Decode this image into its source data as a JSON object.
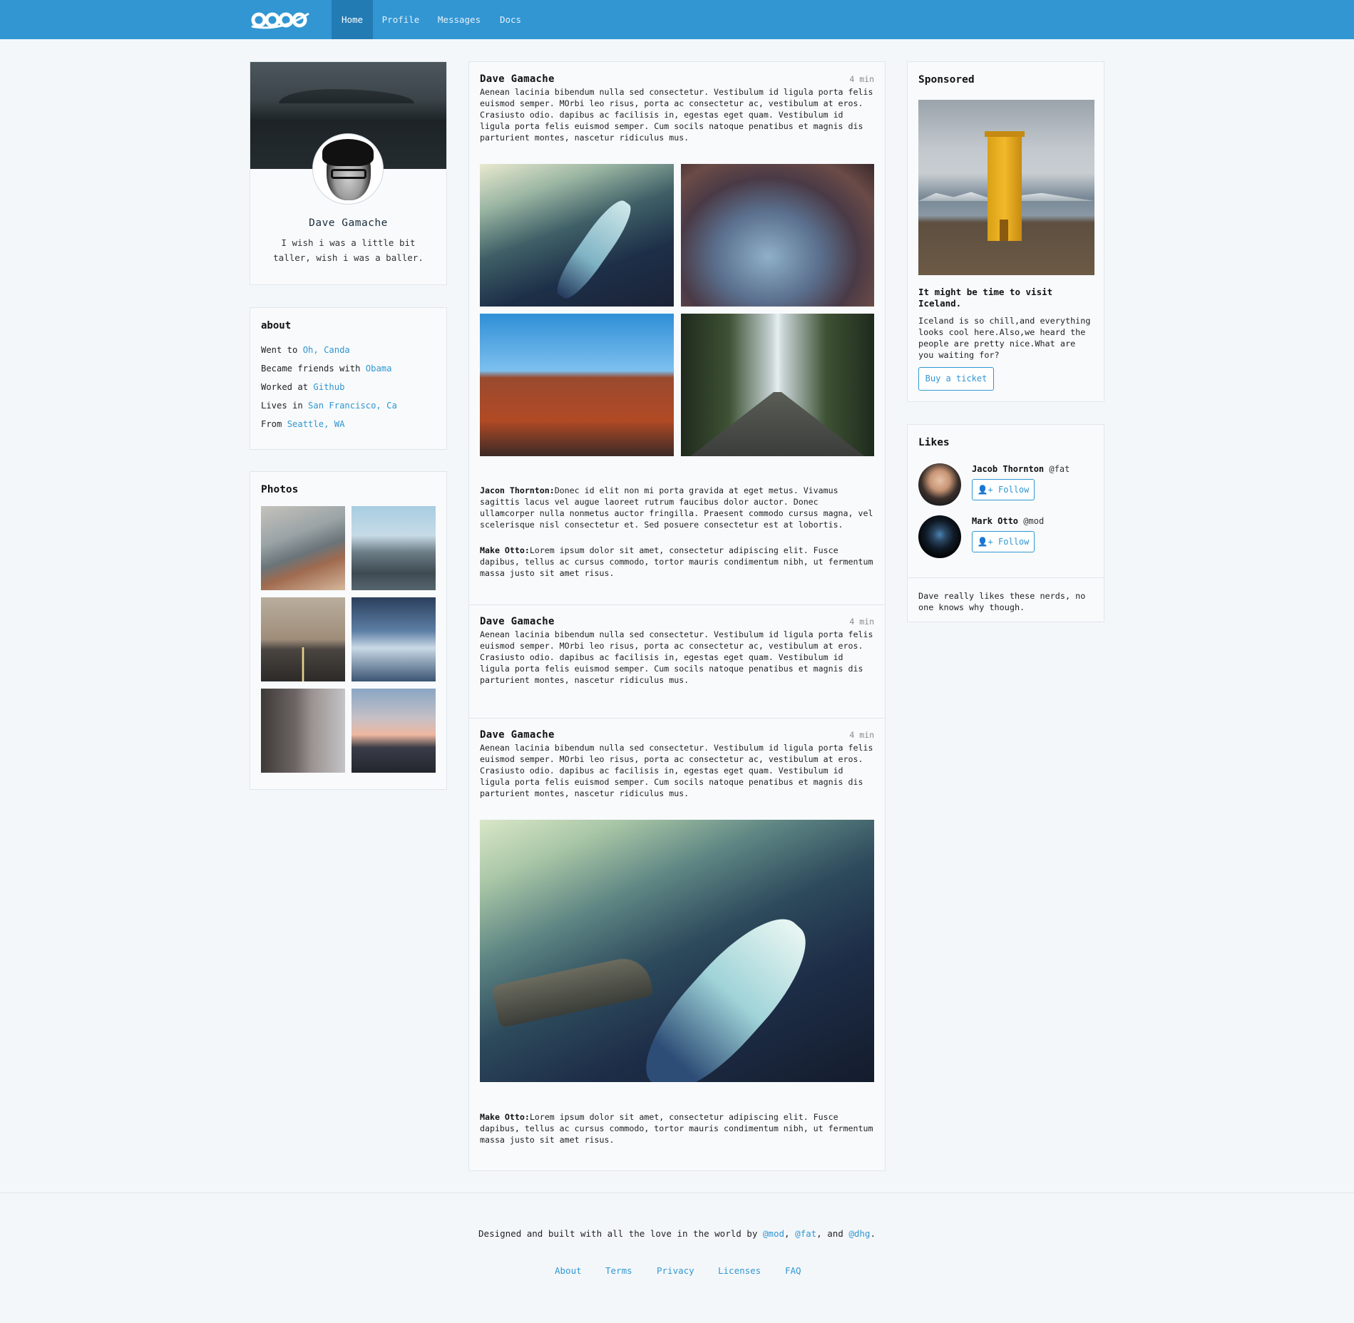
{
  "nav": {
    "items": [
      {
        "label": "Home",
        "active": true
      },
      {
        "label": "Profile",
        "active": false
      },
      {
        "label": "Messages",
        "active": false
      },
      {
        "label": "Docs",
        "active": false
      }
    ]
  },
  "profile": {
    "name": "Dave Gamache",
    "bio": "I wish i was a little bit taller, wish i was a baller."
  },
  "about": {
    "title": "about",
    "items": [
      {
        "prefix": "Went to",
        "link": "Oh, Canda"
      },
      {
        "prefix": "Became friends with",
        "link": "Obama"
      },
      {
        "prefix": "Worked at",
        "link": "Github"
      },
      {
        "prefix": "Lives in",
        "link": "San Francisco, Ca"
      },
      {
        "prefix": "From",
        "link": "Seattle, WA"
      }
    ]
  },
  "photos": {
    "title": "Photos"
  },
  "posts": [
    {
      "author": "Dave Gamache",
      "time": "4 min",
      "text": "Aenean lacinia bibendum nulla sed consectetur. Vestibulum id ligula porta felis euismod semper. MOrbi leo risus, porta ac consectetur ac, vestibulum at eros. Crasiusto odio. dapibus ac facilisis in, egestas eget quam. Vestibulum id ligula porta felis euismod semper. Cum socils natoque penatibus et magnis dis parturient montes, nascetur ridiculus mus.",
      "comments": [
        {
          "author": "Jacon Thornton:",
          "text": "Donec id elit non mi porta gravida at eget metus. Vivamus sagittis lacus vel augue laoreet rutrum faucibus dolor auctor. Donec ullamcorper nulla nonmetus auctor fringilla. Praesent commodo cursus magna, vel scelerisque nisl consectetur et. Sed posuere consectetur est at lobortis."
        },
        {
          "author": "Make Otto:",
          "text": "Lorem ipsum dolor sit amet, consectetur adipiscing elit. Fusce dapibus, tellus ac cursus commodo, tortor mauris condimentum nibh, ut fermentum massa justo sit amet risus."
        }
      ]
    },
    {
      "author": "Dave Gamache",
      "time": "4 min",
      "text": "Aenean lacinia bibendum nulla sed consectetur. Vestibulum id ligula porta felis euismod semper. MOrbi leo risus, porta ac consectetur ac, vestibulum at eros. Crasiusto odio. dapibus ac facilisis in, egestas eget quam. Vestibulum id ligula porta felis euismod semper. Cum socils natoque penatibus et magnis dis parturient montes, nascetur ridiculus mus."
    },
    {
      "author": "Dave Gamache",
      "time": "4 min",
      "text": "Aenean lacinia bibendum nulla sed consectetur. Vestibulum id ligula porta felis euismod semper. MOrbi leo risus, porta ac consectetur ac, vestibulum at eros. Crasiusto odio. dapibus ac facilisis in, egestas eget quam. Vestibulum id ligula porta felis euismod semper. Cum socils natoque penatibus et magnis dis parturient montes, nascetur ridiculus mus.",
      "comments": [
        {
          "author": "Make Otto:",
          "text": "Lorem ipsum dolor sit amet, consectetur adipiscing elit. Fusce dapibus, tellus ac cursus commodo, tortor mauris condimentum nibh, ut fermentum massa justo sit amet risus."
        }
      ]
    }
  ],
  "sponsored": {
    "title": "Sponsored",
    "headline": "It might be time to visit Iceland.",
    "text": "Iceland is so chill,and everything looks cool here.Also,we heard the people are pretty nice.What are you waiting for?",
    "button": "Buy a ticket"
  },
  "likes": {
    "title": "Likes",
    "people": [
      {
        "name": "Jacob Thornton",
        "handle": "@fat",
        "button": "Follow"
      },
      {
        "name": "Mark Otto",
        "handle": "@mod",
        "button": "Follow"
      }
    ],
    "footer": "Dave really likes these nerds, no one knows why though."
  },
  "footer": {
    "prefix": "Designed and built with all the love in the world by",
    "mentions": [
      "@mod",
      "@fat",
      "@dhg"
    ],
    "and": "and",
    "links": [
      "About",
      "Terms",
      "Privacy",
      "Licenses",
      "FAQ"
    ]
  },
  "colors": {
    "brand": "#3296d3",
    "brand_active": "#237bb4",
    "link": "#3097d1",
    "background": "#f4f7fa"
  }
}
